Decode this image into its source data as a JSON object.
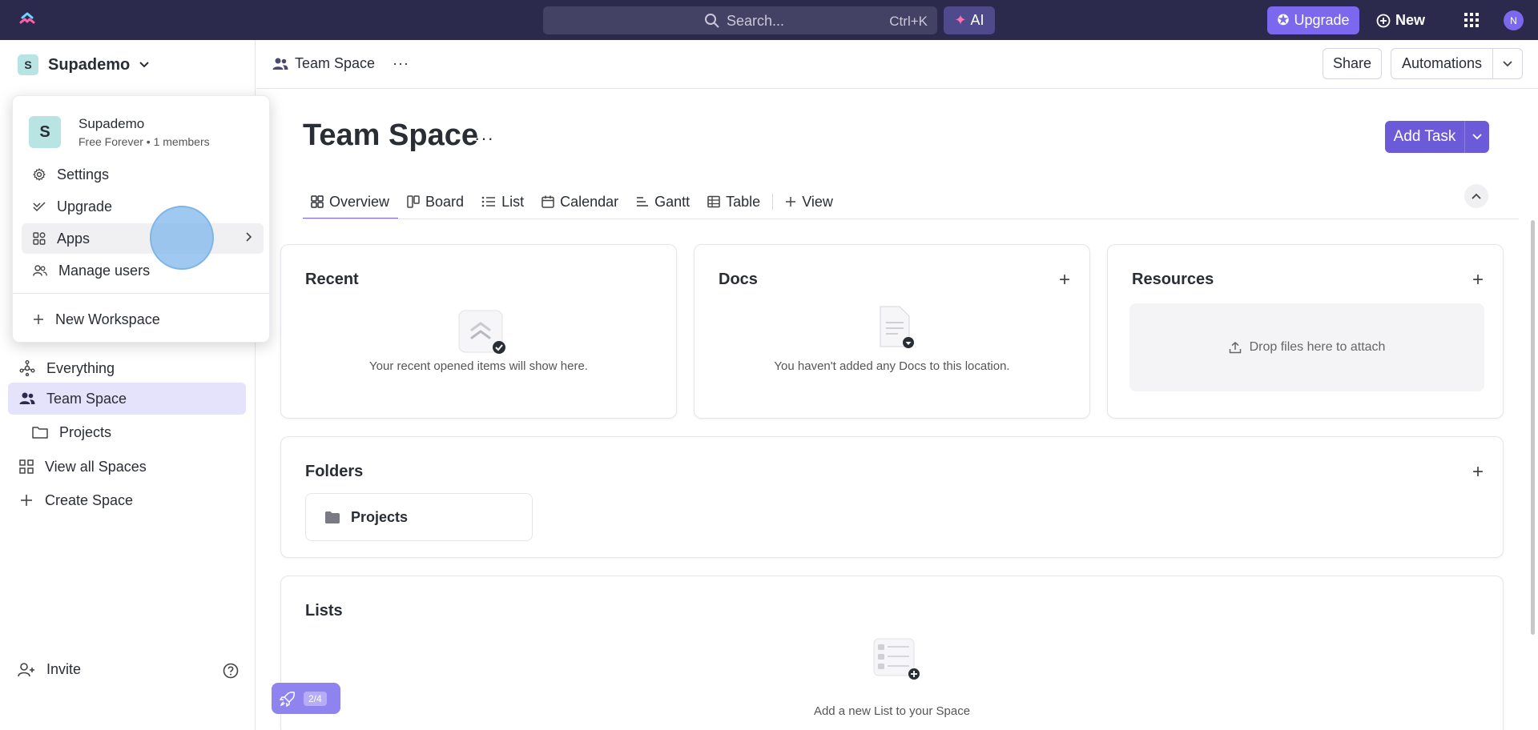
{
  "topbar": {
    "search_placeholder": "Search...",
    "search_shortcut": "Ctrl+K",
    "ai_label": "AI",
    "upgrade_label": "Upgrade",
    "new_label": "New",
    "avatar_initial": "N",
    "colors": {
      "bar": "#2b2a4c",
      "accent": "#7b68ee"
    }
  },
  "sidebar": {
    "workspace_initial": "S",
    "workspace_name": "Supademo",
    "items": [
      {
        "label": "Everything",
        "icon": "everything-icon"
      },
      {
        "label": "Team Space",
        "icon": "team-icon"
      },
      {
        "label": "Projects",
        "icon": "folder-icon"
      },
      {
        "label": "View all Spaces",
        "icon": "grid-icon"
      },
      {
        "label": "Create Space",
        "icon": "plus-icon"
      }
    ],
    "invite_label": "Invite"
  },
  "dropdown": {
    "avatar_initial": "S",
    "name": "Supademo",
    "plan": "Free Forever • 1 members",
    "items": [
      {
        "label": "Settings",
        "icon": "gear-icon"
      },
      {
        "label": "Upgrade",
        "icon": "upgrade-icon"
      },
      {
        "label": "Apps",
        "icon": "apps-icon"
      },
      {
        "label": "Manage users",
        "icon": "users-icon"
      },
      {
        "label": "New Workspace",
        "icon": "plus-icon"
      }
    ]
  },
  "header": {
    "breadcrumb": "Team Space",
    "share_label": "Share",
    "automations_label": "Automations"
  },
  "main": {
    "title": "Team Space",
    "add_task_label": "Add Task",
    "tabs": [
      {
        "label": "Overview",
        "icon": "overview-icon"
      },
      {
        "label": "Board",
        "icon": "board-icon"
      },
      {
        "label": "List",
        "icon": "list-icon"
      },
      {
        "label": "Calendar",
        "icon": "calendar-icon"
      },
      {
        "label": "Gantt",
        "icon": "gantt-icon"
      },
      {
        "label": "Table",
        "icon": "table-icon"
      },
      {
        "label": "View",
        "icon": "plus-icon"
      }
    ],
    "cards": {
      "recent": {
        "title": "Recent",
        "empty": "Your recent opened items will show here."
      },
      "docs": {
        "title": "Docs",
        "empty": "You haven't added any Docs to this location."
      },
      "resources": {
        "title": "Resources",
        "drop": "Drop files here to attach"
      },
      "folders": {
        "title": "Folders",
        "items": [
          "Projects"
        ]
      },
      "lists": {
        "title": "Lists",
        "empty": "Add a new List to your Space"
      }
    },
    "onboarding_progress": "2/4"
  }
}
